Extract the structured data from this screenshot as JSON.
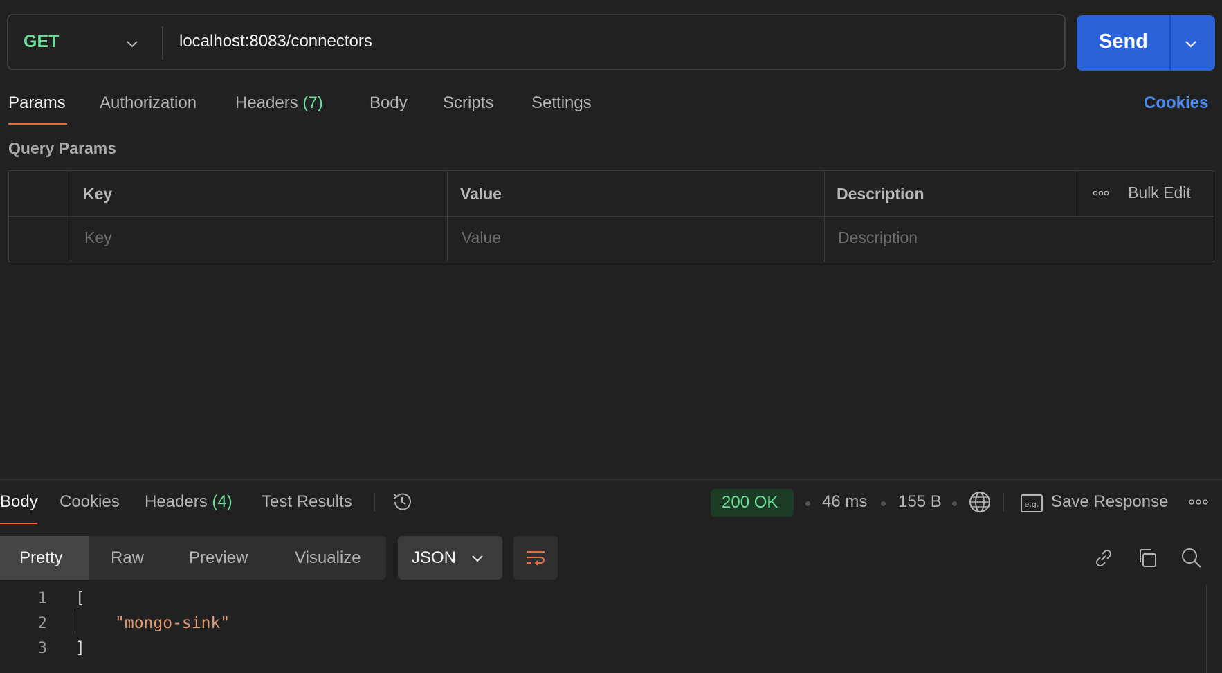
{
  "request": {
    "method": "GET",
    "url": "localhost:8083/connectors",
    "send_label": "Send"
  },
  "request_tabs": {
    "params": "Params",
    "authorization": "Authorization",
    "headers": "Headers",
    "headers_count": "(7)",
    "body": "Body",
    "scripts": "Scripts",
    "settings": "Settings",
    "cookies": "Cookies"
  },
  "query_params": {
    "title": "Query Params",
    "columns": {
      "key": "Key",
      "value": "Value",
      "description": "Description"
    },
    "bulk_edit": "Bulk Edit",
    "placeholders": {
      "key": "Key",
      "value": "Value",
      "description": "Description"
    }
  },
  "response_tabs": {
    "body": "Body",
    "cookies": "Cookies",
    "headers": "Headers",
    "headers_count": "(4)",
    "test_results": "Test Results"
  },
  "response_meta": {
    "status": "200 OK",
    "time": "46 ms",
    "size": "155 B",
    "save_response": "Save Response"
  },
  "response_format": {
    "modes": [
      "Pretty",
      "Raw",
      "Preview",
      "Visualize"
    ],
    "active_mode": "Pretty",
    "language": "JSON"
  },
  "response_body": {
    "lines": [
      {
        "num": "1",
        "text": "["
      },
      {
        "num": "2",
        "text": "\"mongo-sink\""
      },
      {
        "num": "3",
        "text": "]"
      }
    ]
  },
  "colors": {
    "accent_orange": "#e86a3a",
    "send_blue": "#2a63d8",
    "status_green": "#6bdd9a",
    "link_blue": "#4c8cf0"
  },
  "icons": [
    "chevron-down-icon",
    "history-icon",
    "globe-icon",
    "example-icon",
    "more-icon",
    "wrap-lines-icon",
    "link-icon",
    "copy-icon",
    "search-icon"
  ]
}
